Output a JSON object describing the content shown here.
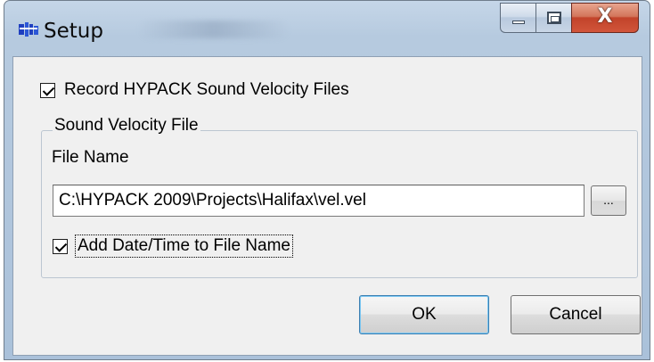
{
  "window": {
    "title": "Setup",
    "icon": "hypack-app-icon",
    "controls": {
      "minimize_icon": "minimize-icon",
      "maximize_icon": "maximize-icon",
      "close_glyph": "X"
    }
  },
  "record_checkbox": {
    "label": "Record HYPACK Sound Velocity Files",
    "checked": true
  },
  "group": {
    "legend": "Sound Velocity File",
    "file_name_label": "File Name",
    "file_name_value": "C:\\HYPACK 2009\\Projects\\Halifax\\vel.vel",
    "browse_label": "...",
    "add_datetime": {
      "label": "Add Date/Time to File Name",
      "checked": true
    }
  },
  "buttons": {
    "ok": "OK",
    "cancel": "Cancel"
  },
  "colors": {
    "titlebar": "#b6cadf",
    "client_bg": "#f0f0f0",
    "close_button": "#c2432a",
    "default_button_border": "#3c7fb1"
  }
}
